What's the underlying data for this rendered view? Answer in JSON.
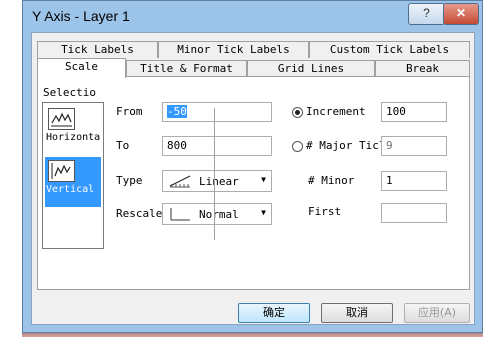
{
  "window": {
    "title": "Y Axis - Layer 1",
    "help_label": "?",
    "close_label": "✕"
  },
  "tabs": {
    "row_back": [
      "Tick Labels",
      "Minor Tick Labels",
      "Custom Tick Labels"
    ],
    "row_front": [
      "Scale",
      "Title & Format",
      "Grid Lines",
      "Break"
    ],
    "active": "Scale"
  },
  "selection": {
    "label": "Selectio",
    "items": [
      {
        "label": "Horizonta",
        "icon": "horizontal-axis-icon",
        "selected": false
      },
      {
        "label": "Vertical",
        "icon": "vertical-axis-icon",
        "selected": true
      }
    ]
  },
  "scale": {
    "from_label": "From",
    "from_value": "-50",
    "to_label": "To",
    "to_value": "800",
    "type_label": "Type",
    "type_value": "Linear",
    "rescale_label": "Rescale",
    "rescale_value": "Normal"
  },
  "ticks": {
    "increment_label": "Increment",
    "increment_value": "100",
    "increment_selected": true,
    "major_label": "# Major Ticl",
    "major_value": "9",
    "major_selected": false,
    "minor_label": "# Minor",
    "minor_value": "1",
    "first_label": "First",
    "first_value": ""
  },
  "buttons": {
    "ok": "确定",
    "cancel": "取消",
    "apply": "应用(A)"
  },
  "colors": {
    "title_bar": "#9cc4e8",
    "selection_highlight": "#3399ff",
    "close_button": "#c54a35"
  }
}
